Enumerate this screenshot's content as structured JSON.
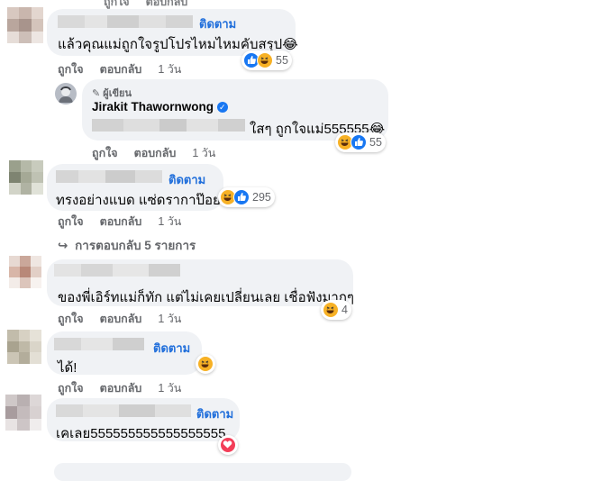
{
  "actions": {
    "like": "ถูกใจ",
    "reply": "ตอบกลับ",
    "time": "1 วัน"
  },
  "follow_label": "ติดตาม",
  "comments": [
    {
      "id": "c1",
      "text": "แล้วคุณแม่ถูกใจรูปโปรไหมไหมคับสรุป😂",
      "reactions": [
        "like",
        "haha"
      ],
      "count": "55"
    },
    {
      "id": "c1r",
      "author_badge": "ผู้เขียน",
      "author": "Jirakit Thawornwong",
      "verified_icon": "verified-badge-icon",
      "text": "ใสๆ ถูกใจแม่555555😂",
      "reactions": [
        "haha",
        "like"
      ],
      "count": "55"
    },
    {
      "id": "c2",
      "text": "ทรงอย่างแบด แซ่ดรากาป๊อย",
      "reactions": [
        "haha",
        "like"
      ],
      "count": "295"
    },
    {
      "id": "c2more",
      "text": "การตอบกลับ 5 รายการ"
    },
    {
      "id": "c3",
      "text": "ของพี่เอิร์ทแม่ก็ทัก แต่ไม่เคยเปลี่ยนเลย เชื่อฟังมากๆ",
      "reactions": [
        "haha"
      ],
      "count": "4"
    },
    {
      "id": "c4",
      "text": "ได้!",
      "reactions": [
        "haha"
      ],
      "count": ""
    },
    {
      "id": "c5",
      "text": "เคเลย555555555555555555",
      "reactions": [
        "love"
      ],
      "count": ""
    }
  ],
  "colors": {
    "link": "#216fdb",
    "bubble": "#f0f2f5",
    "muted": "#65676b"
  }
}
